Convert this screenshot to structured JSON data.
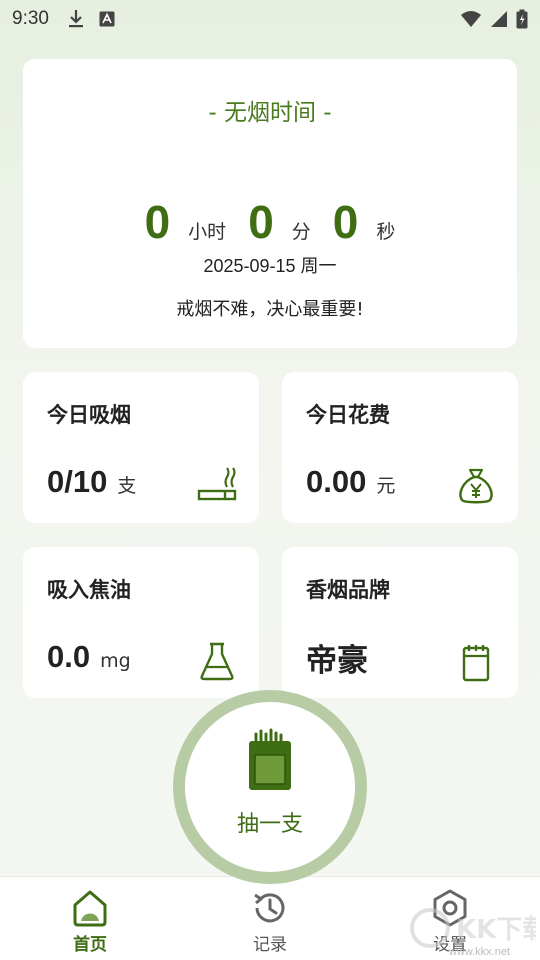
{
  "status_bar": {
    "time": "9:30",
    "icons": [
      "download-icon",
      "keyboard-a-icon",
      "wifi-icon",
      "signal-icon",
      "battery-icon"
    ]
  },
  "timer": {
    "title": "- 无烟时间 -",
    "hours": "0",
    "hours_unit": "小时",
    "minutes": "0",
    "minutes_unit": "分",
    "seconds": "0",
    "seconds_unit": "秒",
    "date": "2025-09-15 周一",
    "motto": "戒烟不难，决心最重要!"
  },
  "stats": {
    "today_smoke": {
      "title": "今日吸烟",
      "value": "0/10",
      "unit": "支",
      "icon": "cigarette-icon"
    },
    "today_cost": {
      "title": "今日花费",
      "value": "0.00",
      "unit": "元",
      "icon": "money-bag-icon"
    },
    "tar": {
      "title": "吸入焦油",
      "value": "0.0",
      "unit": "mg",
      "icon": "flask-icon"
    },
    "brand": {
      "title": "香烟品牌",
      "value": "帝豪",
      "icon": "notepad-icon"
    }
  },
  "smoke_button": {
    "label": "抽一支",
    "icon": "cigarette-pack-icon"
  },
  "bottom_nav": {
    "items": [
      {
        "label": "首页",
        "icon": "home-icon",
        "active": true
      },
      {
        "label": "记录",
        "icon": "history-icon",
        "active": false
      },
      {
        "label": "设置",
        "icon": "settings-icon",
        "active": false
      }
    ]
  },
  "watermark": {
    "text": "KK下载",
    "url": "www.kkx.net"
  },
  "colors": {
    "accent": "#3f6d14",
    "accent_light": "#b7cca4",
    "card": "#ffffff",
    "background": "#eef3ea"
  }
}
